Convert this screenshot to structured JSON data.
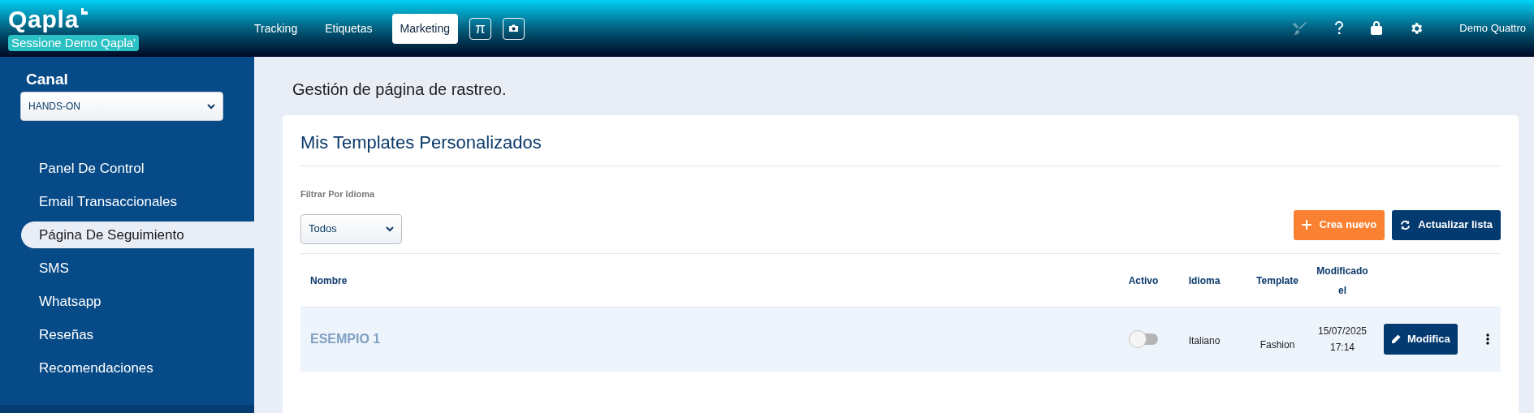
{
  "header": {
    "logo": "Qapla",
    "session_badge": "Sessione Demo Qapla'",
    "nav": [
      {
        "kind": "text",
        "label": "Tracking",
        "selected": false
      },
      {
        "kind": "text",
        "label": "Etiquetas",
        "selected": false
      },
      {
        "kind": "text",
        "label": "Marketing",
        "selected": true
      },
      {
        "kind": "glyph",
        "label": "π",
        "selected": false
      },
      {
        "kind": "camera",
        "selected": false
      }
    ],
    "tools": [
      {
        "kind": "brush",
        "disabled": true
      },
      {
        "kind": "help",
        "disabled": false
      },
      {
        "kind": "bag",
        "disabled": false
      },
      {
        "kind": "gear",
        "disabled": false
      }
    ],
    "user": "Demo Quattro"
  },
  "sidebar": {
    "channel_label": "Canal",
    "channel_value": "HANDS-ON",
    "items": [
      {
        "label": "Panel De Control",
        "selected": false
      },
      {
        "label": "Email Transaccionales",
        "selected": false
      },
      {
        "label": "Página De Seguimiento",
        "selected": true
      },
      {
        "label": "SMS",
        "selected": false
      },
      {
        "label": "Whatsapp",
        "selected": false
      },
      {
        "label": "Reseñas",
        "selected": false
      },
      {
        "label": "Recomendaciones",
        "selected": false
      }
    ]
  },
  "page_title": "Gestión de página de rastreo.",
  "card": {
    "title": "Mis Templates Personalizados",
    "filter_label": "Filtrar Por Idioma",
    "filter_value": "Todos",
    "buttons": [
      {
        "kind": "create",
        "label": "Crea nuevo"
      },
      {
        "kind": "refresh",
        "label": "Actualizar lista"
      }
    ],
    "table": {
      "columns": [
        "Nombre",
        "Activo",
        "Idioma",
        "Template",
        "Modificado el"
      ],
      "rows": [
        {
          "name": "ESEMPIO 1",
          "active": false,
          "language": "Italiano",
          "template": "Fashion",
          "modified": "15/07/2025 17:14",
          "edit_label": "Modifica"
        }
      ]
    }
  }
}
